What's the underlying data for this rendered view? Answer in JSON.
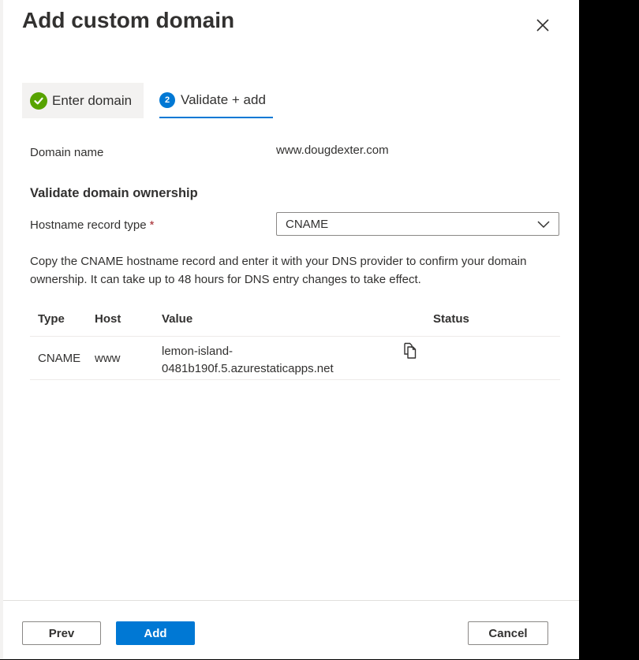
{
  "window": {
    "title": "Add custom domain"
  },
  "steps": [
    {
      "label": "Enter domain",
      "state": "complete"
    },
    {
      "number": "2",
      "label": "Validate + add",
      "state": "active"
    }
  ],
  "domain": {
    "label": "Domain name",
    "value": "www.dougdexter.com"
  },
  "validation": {
    "heading": "Validate domain ownership",
    "record_type_label": "Hostname record type",
    "required_marker": "*",
    "record_type_value": "CNAME",
    "description": "Copy the CNAME hostname record and enter it with your DNS provider to confirm your domain ownership. It can take up to 48 hours for DNS entry changes to take effect."
  },
  "table": {
    "headers": [
      "Type",
      "Host",
      "Value",
      "Status"
    ],
    "rows": [
      {
        "type": "CNAME",
        "host": "www",
        "value_line1": "lemon-island-",
        "value_line2": "0481b190f.5.azurestaticapps.net",
        "status": ""
      }
    ]
  },
  "footer": {
    "prev_label": "Prev",
    "add_label": "Add",
    "cancel_label": "Cancel"
  },
  "colors": {
    "accent": "#0078d4",
    "success": "#57a300",
    "required": "#a4262c"
  },
  "icons": {
    "close": "close-icon",
    "check": "checkmark-circle-icon",
    "chevron": "chevron-down-icon",
    "copy": "copy-icon"
  }
}
